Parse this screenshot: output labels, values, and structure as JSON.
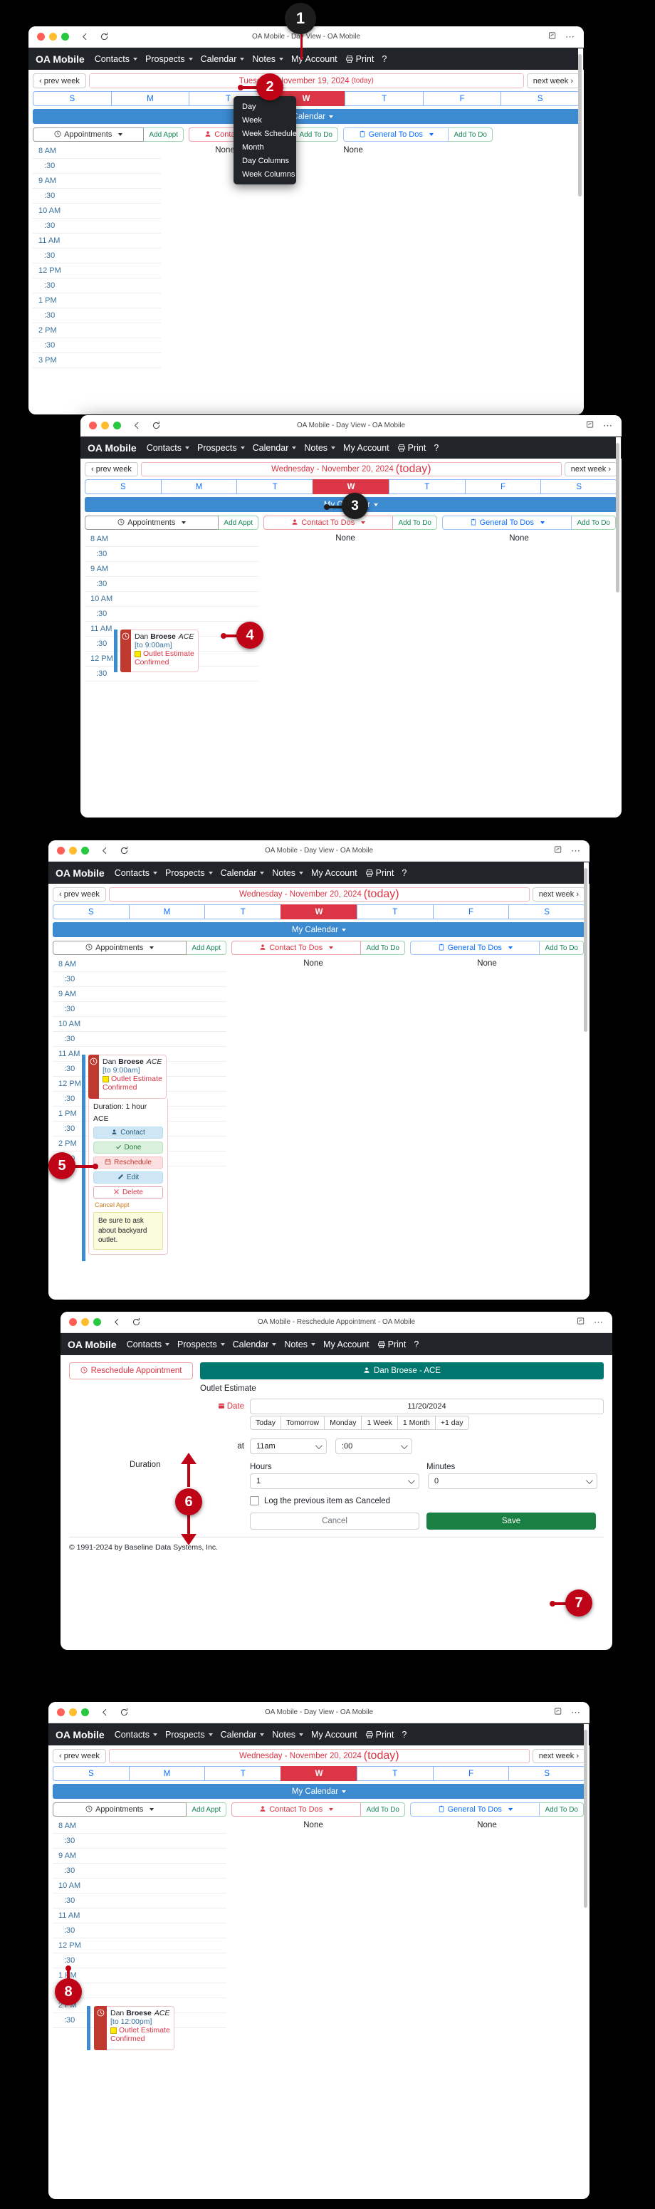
{
  "browser": {
    "title_day": "OA Mobile - Day View - OA Mobile",
    "title_resched": "OA Mobile - Reschedule Appointment - OA Mobile",
    "back_icon": "back-arrow-icon",
    "reload_icon": "reload-icon",
    "share_icon": "share-icon",
    "more_icon": "more-options-icon"
  },
  "navbar": {
    "brand": "OA Mobile",
    "items": [
      {
        "label": "Contacts",
        "caret": true
      },
      {
        "label": "Prospects",
        "caret": true
      },
      {
        "label": "Calendar",
        "caret": true
      },
      {
        "label": "Notes",
        "caret": true
      },
      {
        "label": "My Account",
        "caret": false
      },
      {
        "label": "Print",
        "caret": false
      },
      {
        "label": "?",
        "caret": false
      }
    ]
  },
  "calendar_menu": {
    "items": [
      "Day",
      "Week",
      "Week Schedule",
      "Month",
      "Day Columns",
      "Week Columns"
    ]
  },
  "weeknav": {
    "prev": "‹ prev week",
    "next": "next week ›",
    "date_w1": "Tuesday - November 19, 2024",
    "date_w1_suffix": "(today)",
    "date_main": "Wednesday - November 20, 2024",
    "date_main_suffix": "(today)"
  },
  "days": [
    "S",
    "M",
    "T",
    "W",
    "T",
    "F",
    "S"
  ],
  "days_active_index": 3,
  "mycalendar": "My Calendar",
  "columns": {
    "appointments": {
      "label": "Appointments",
      "icon": "clock-icon",
      "add": "Add Appt"
    },
    "contact_todos": {
      "label": "Contact To Dos",
      "icon": "person-icon",
      "add": "Add To Do"
    },
    "general_todos": {
      "label": "General To Dos",
      "icon": "clipboard-icon",
      "add": "Add To Do"
    },
    "none_text": "None"
  },
  "timeslots_w1": [
    "8 AM",
    ":30",
    "9 AM",
    ":30",
    "10 AM",
    ":30",
    "11 AM",
    ":30",
    "12 PM",
    ":30",
    "1 PM",
    ":30",
    "2 PM",
    ":30",
    "3 PM"
  ],
  "timeslots_w2": [
    "8 AM",
    ":30",
    "9 AM",
    ":30",
    "10 AM",
    ":30",
    "11 AM",
    ":30",
    "12 PM",
    ":30"
  ],
  "timeslots_w3": [
    "8 AM",
    ":30",
    "9 AM",
    ":30",
    "10 AM",
    ":30",
    "11 AM",
    ":30",
    "12 PM",
    ":30",
    "1 PM",
    ":30",
    "2 PM",
    ":30"
  ],
  "timeslots_w5": [
    "8 AM",
    ":30",
    "9 AM",
    ":30",
    "10 AM",
    ":30",
    "11 AM",
    ":30",
    "12 PM",
    ":30",
    "1 PM",
    ":30",
    "2 PM",
    ":30"
  ],
  "appointment_before": {
    "name_first": "Dan",
    "name_last": "Broese",
    "company": "ACE",
    "time": "[to 9:00am]",
    "type": "Outlet Estimate",
    "status": "Confirmed",
    "swatch_color": "#ffeb00"
  },
  "appointment_after": {
    "name_first": "Dan",
    "name_last": "Broese",
    "company": "ACE",
    "time": "[to 12:00pm]",
    "type": "Outlet Estimate",
    "status": "Confirmed",
    "swatch_color": "#ffeb00"
  },
  "appointment_detail": {
    "duration": "Duration: 1 hour",
    "company": "ACE",
    "actions": [
      {
        "label": "Contact",
        "icon": "person-icon"
      },
      {
        "label": "Done",
        "icon": "check-icon"
      },
      {
        "label": "Reschedule",
        "icon": "calendar-icon"
      },
      {
        "label": "Edit",
        "icon": "pencil-icon"
      },
      {
        "label": "Delete",
        "icon": "close-x-icon"
      }
    ],
    "cancel_appt": "Cancel Appt",
    "note": "Be sure to ask about backyard outlet."
  },
  "reschedule_form": {
    "header_button": "Reschedule Appointment",
    "header_icon": "clock-icon",
    "contact_bar": "Dan Broese - ACE",
    "contact_icon": "person-icon",
    "subject": "Outlet Estimate",
    "date_label": "Date",
    "date_icon": "calendar-icon",
    "date_value": "11/20/2024",
    "quick_dates": [
      "Today",
      "Tomorrow",
      "Monday",
      "1 Week",
      "1 Month",
      "+1 day"
    ],
    "at_label": "at",
    "hour_value": "11am",
    "minute_value": ":00",
    "duration_label": "Duration",
    "hours_label": "Hours",
    "minutes_label": "Minutes",
    "hours_value": "1",
    "minutes_value": "0",
    "checkbox_label": "Log the previous item as Canceled",
    "cancel_button": "Cancel",
    "save_button": "Save",
    "copyright": "© 1991-2024 by Baseline Data Systems, Inc."
  },
  "callouts": [
    {
      "n": "1",
      "style": "dark"
    },
    {
      "n": "2",
      "style": "red"
    },
    {
      "n": "3",
      "style": "dark"
    },
    {
      "n": "4",
      "style": "red"
    },
    {
      "n": "5",
      "style": "red"
    },
    {
      "n": "6",
      "style": "red"
    },
    {
      "n": "7",
      "style": "red"
    },
    {
      "n": "8",
      "style": "red"
    }
  ]
}
